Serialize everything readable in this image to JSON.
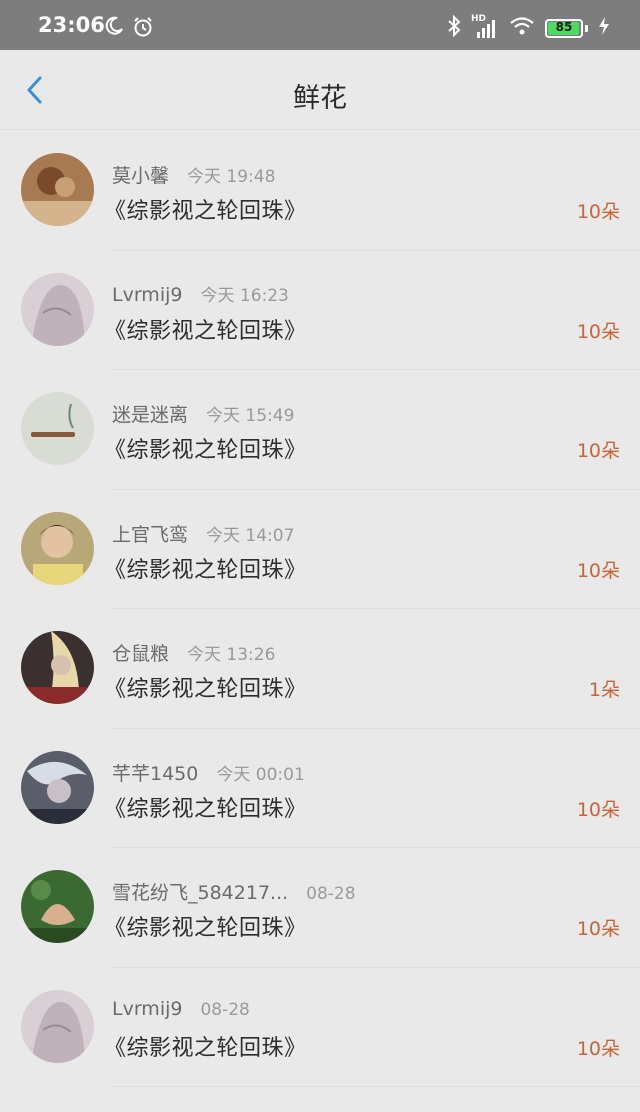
{
  "status_bar": {
    "time": "23:06",
    "battery": "85",
    "icons": [
      "moon-icon",
      "alarm-icon",
      "bluetooth-icon",
      "hd-signal-icon",
      "wifi-icon",
      "battery-icon",
      "charging-icon"
    ],
    "signal_label": "HD"
  },
  "header": {
    "title": "鲜花",
    "back_icon": "chevron-left-icon",
    "accent_color": "#3a8fd6"
  },
  "colors": {
    "count": "#c8643a",
    "name": "#6b6b6b",
    "time": "#9a9a9a"
  },
  "items": [
    {
      "user": "莫小馨",
      "time": "今天 19:48",
      "book": "《综影视之轮回珠》",
      "count": "10朵"
    },
    {
      "user": "Lvrmij9",
      "time": "今天 16:23",
      "book": "《综影视之轮回珠》",
      "count": "10朵"
    },
    {
      "user": "迷是迷离",
      "time": "今天 15:49",
      "book": "《综影视之轮回珠》",
      "count": "10朵"
    },
    {
      "user": "上官飞鸾",
      "time": "今天 14:07",
      "book": "《综影视之轮回珠》",
      "count": "10朵"
    },
    {
      "user": "仓鼠粮",
      "time": "今天 13:26",
      "book": "《综影视之轮回珠》",
      "count": "1朵"
    },
    {
      "user": "芊芊1450",
      "time": "今天 00:01",
      "book": "《综影视之轮回珠》",
      "count": "10朵"
    },
    {
      "user": "雪花纷飞_584217...",
      "time": "08-28",
      "book": "《综影视之轮回珠》",
      "count": "10朵"
    },
    {
      "user": "Lvrmij9",
      "time": "08-28",
      "book": "《综影视之轮回珠》",
      "count": "10朵"
    }
  ]
}
